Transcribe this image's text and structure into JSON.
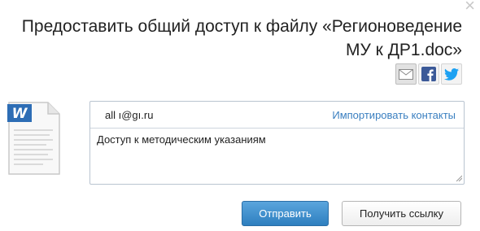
{
  "dialog": {
    "title_line1": "Предоставить общий доступ к файлу «Регионоведение",
    "title_line2": "МУ к ДР1.doc»",
    "close_glyph": "×"
  },
  "share_icons": [
    "mail-icon",
    "facebook-icon",
    "twitter-icon"
  ],
  "form": {
    "recipient_value": "all ı@gı.ru",
    "import_contacts_label": "Импортировать контакты",
    "message_value": "Доступ к методическим указаниям"
  },
  "buttons": {
    "send_label": "Отправить",
    "get_link_label": "Получить ссылку"
  },
  "colors": {
    "accent": "#2e7fbf",
    "link": "#3a7fc0",
    "word_icon": "#2d6db5"
  }
}
